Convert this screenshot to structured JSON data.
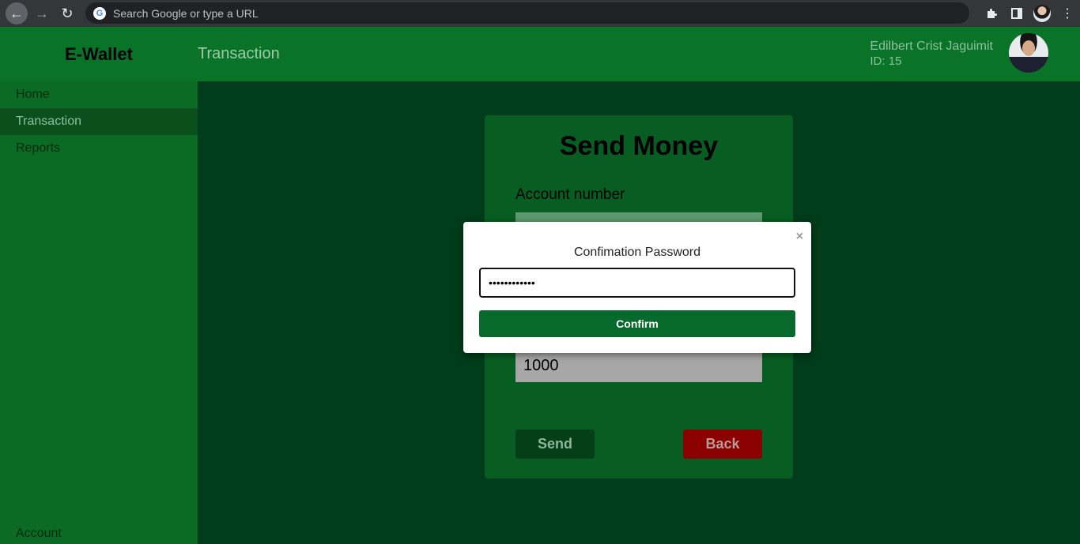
{
  "browser": {
    "omnibox_placeholder": "Search Google or type a URL",
    "google_letter": "G"
  },
  "header": {
    "brand": "E-Wallet",
    "page_title": "Transaction",
    "user_name": "Edilbert Crist Jaguimit",
    "user_id": "ID: 15"
  },
  "sidebar": {
    "items": [
      {
        "label": "Home"
      },
      {
        "label": "Transaction"
      },
      {
        "label": "Reports"
      }
    ],
    "account_label": "Account"
  },
  "form": {
    "title": "Send Money",
    "account_label": "Account number",
    "amount_value": "1000",
    "send_label": "Send",
    "back_label": "Back"
  },
  "modal": {
    "close_glyph": "×",
    "title": "Confimation Password",
    "password_value": "••••••••••••",
    "confirm_label": "Confirm"
  },
  "colors": {
    "header_bg": "#097428",
    "sidebar_bg": "#0b6a23",
    "main_bg": "#013d1a",
    "card_bg": "#085e22",
    "confirm_btn": "#07692c",
    "back_btn": "#8b0000"
  }
}
